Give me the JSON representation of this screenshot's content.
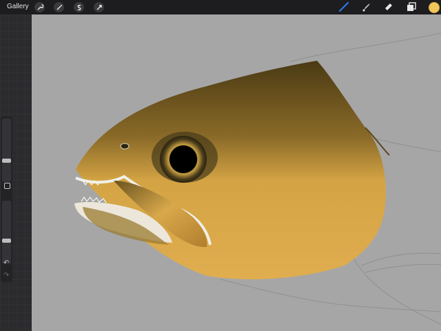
{
  "topbar": {
    "gallery_label": "Gallery",
    "left_tools": [
      "wrench-icon",
      "magic-wand-icon",
      "selection-icon",
      "transform-icon"
    ],
    "right_tools": [
      "brush-icon",
      "smudge-icon",
      "eraser-icon",
      "layers-icon"
    ],
    "active_tool": "brush-icon",
    "current_color": "#f1c75b"
  },
  "sidebar": {
    "brush_size": 0.3,
    "brush_opacity": 0.5,
    "modify_button": "square-icon",
    "undo_icon": "undo-icon",
    "redo_icon": "redo-icon"
  },
  "canvas": {
    "subject": "fish-head-painting"
  }
}
